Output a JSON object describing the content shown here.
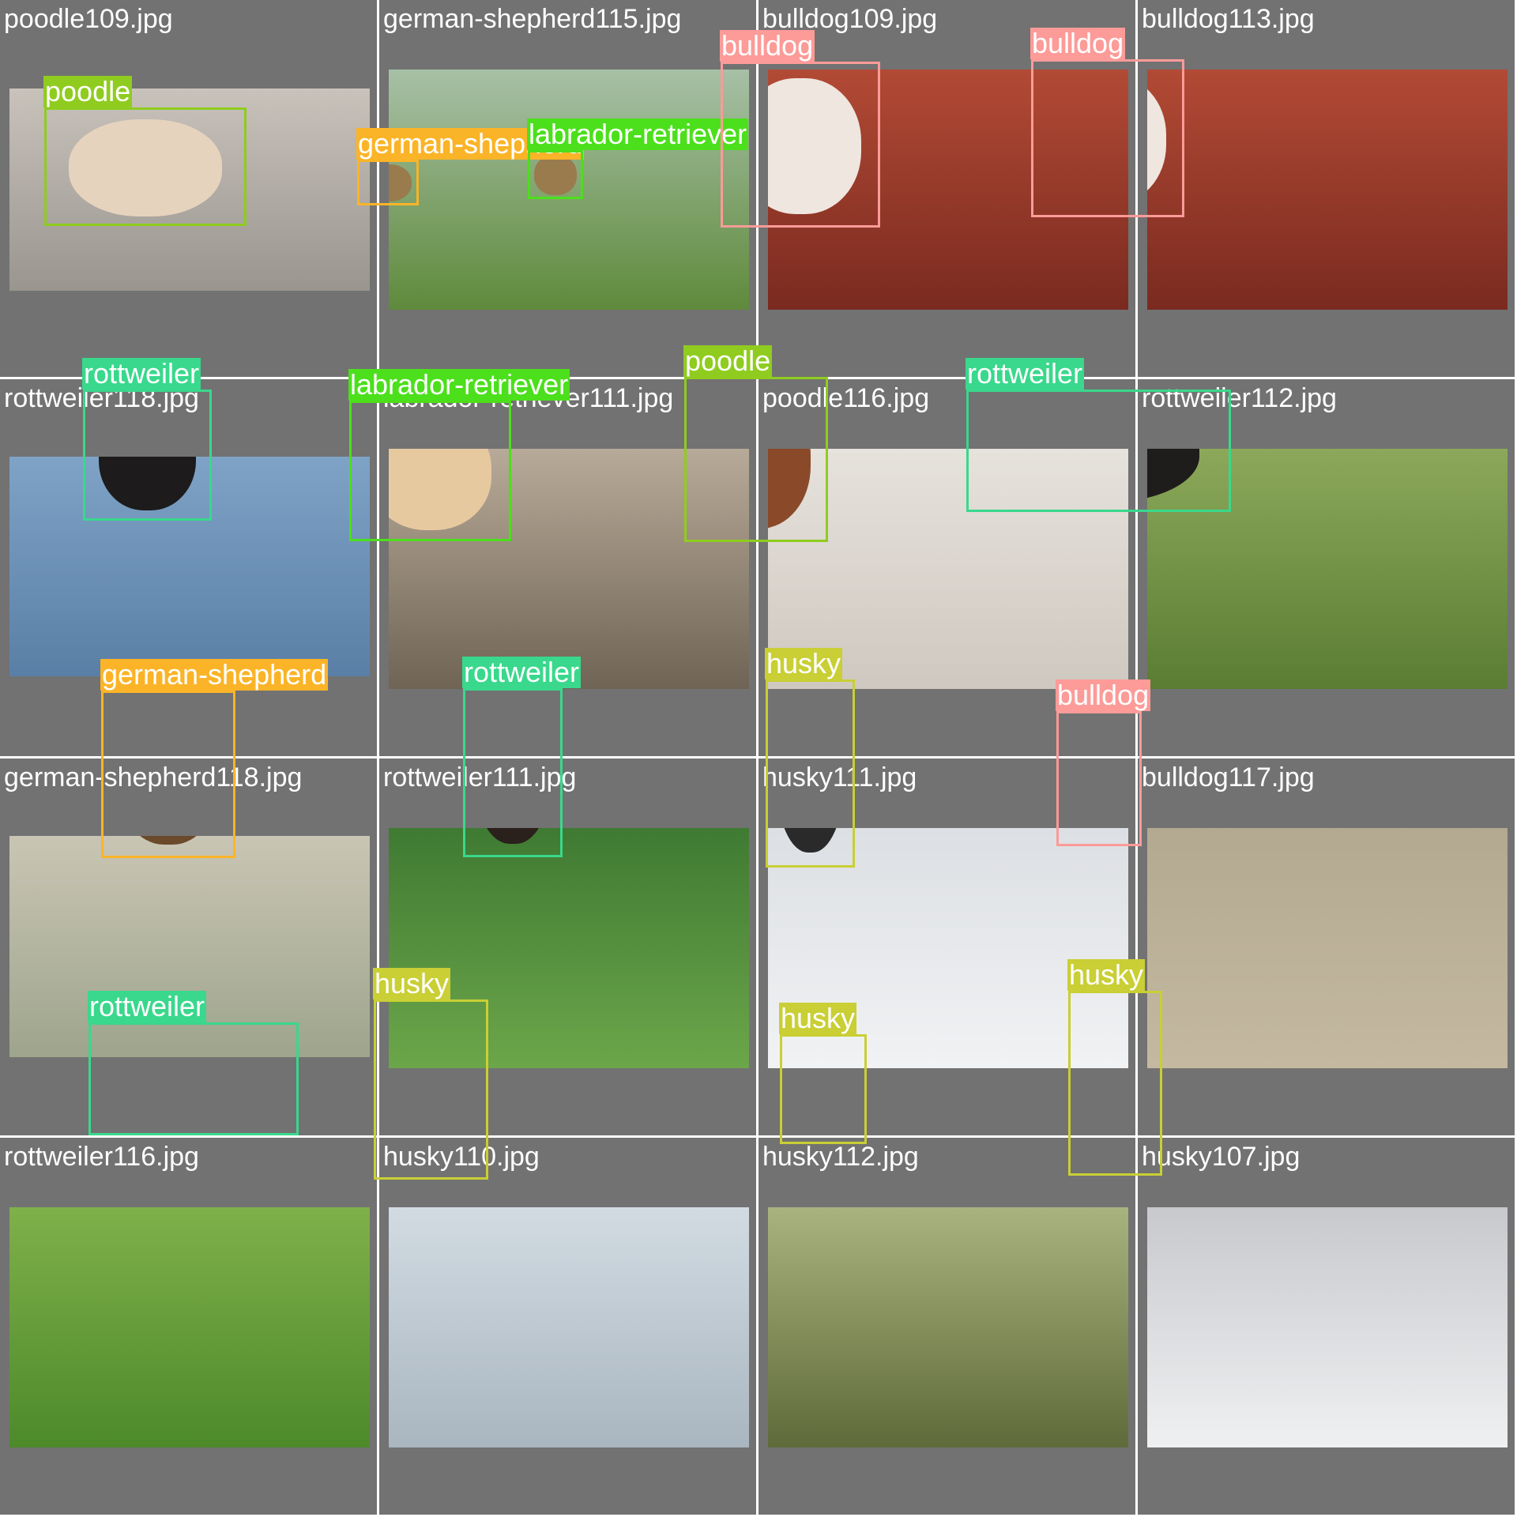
{
  "classes": {
    "poodle": "#8fcc1f",
    "german-shepherd": "#fbb427",
    "bulldog": "#fc9b98",
    "labrador-retriever": "#4cdf1c",
    "rottweiler": "#39d88c",
    "husky": "#c9cf34"
  },
  "tiles": [
    {
      "file": "poodle109.jpg",
      "detections": [
        {
          "label": "poodle"
        }
      ]
    },
    {
      "file": "german-shepherd115.jpg",
      "detections": [
        {
          "label": "german-shepherd"
        },
        {
          "label": "labrador-retriever"
        }
      ]
    },
    {
      "file": "bulldog109.jpg",
      "detections": [
        {
          "label": "bulldog"
        }
      ]
    },
    {
      "file": "bulldog113.jpg",
      "detections": [
        {
          "label": "bulldog"
        }
      ]
    },
    {
      "file": "rottweiler118.jpg",
      "detections": [
        {
          "label": "rottweiler"
        }
      ]
    },
    {
      "file": "labrador-retriever111.jpg",
      "detections": [
        {
          "label": "labrador-retriever"
        }
      ]
    },
    {
      "file": "poodle116.jpg",
      "detections": [
        {
          "label": "poodle"
        }
      ]
    },
    {
      "file": "rottweiler112.jpg",
      "detections": [
        {
          "label": "rottweiler"
        }
      ]
    },
    {
      "file": "german-shepherd118.jpg",
      "detections": [
        {
          "label": "german-shepherd"
        }
      ]
    },
    {
      "file": "rottweiler111.jpg",
      "detections": [
        {
          "label": "rottweiler"
        }
      ]
    },
    {
      "file": "husky111.jpg",
      "detections": [
        {
          "label": "husky"
        }
      ]
    },
    {
      "file": "bulldog117.jpg",
      "detections": [
        {
          "label": "bulldog"
        }
      ]
    },
    {
      "file": "rottweiler116.jpg",
      "detections": [
        {
          "label": "rottweiler"
        }
      ]
    },
    {
      "file": "husky110.jpg",
      "detections": [
        {
          "label": "husky"
        }
      ]
    },
    {
      "file": "husky112.jpg",
      "detections": [
        {
          "label": "husky"
        }
      ]
    },
    {
      "file": "husky107.jpg",
      "detections": [
        {
          "label": "husky"
        }
      ]
    }
  ]
}
